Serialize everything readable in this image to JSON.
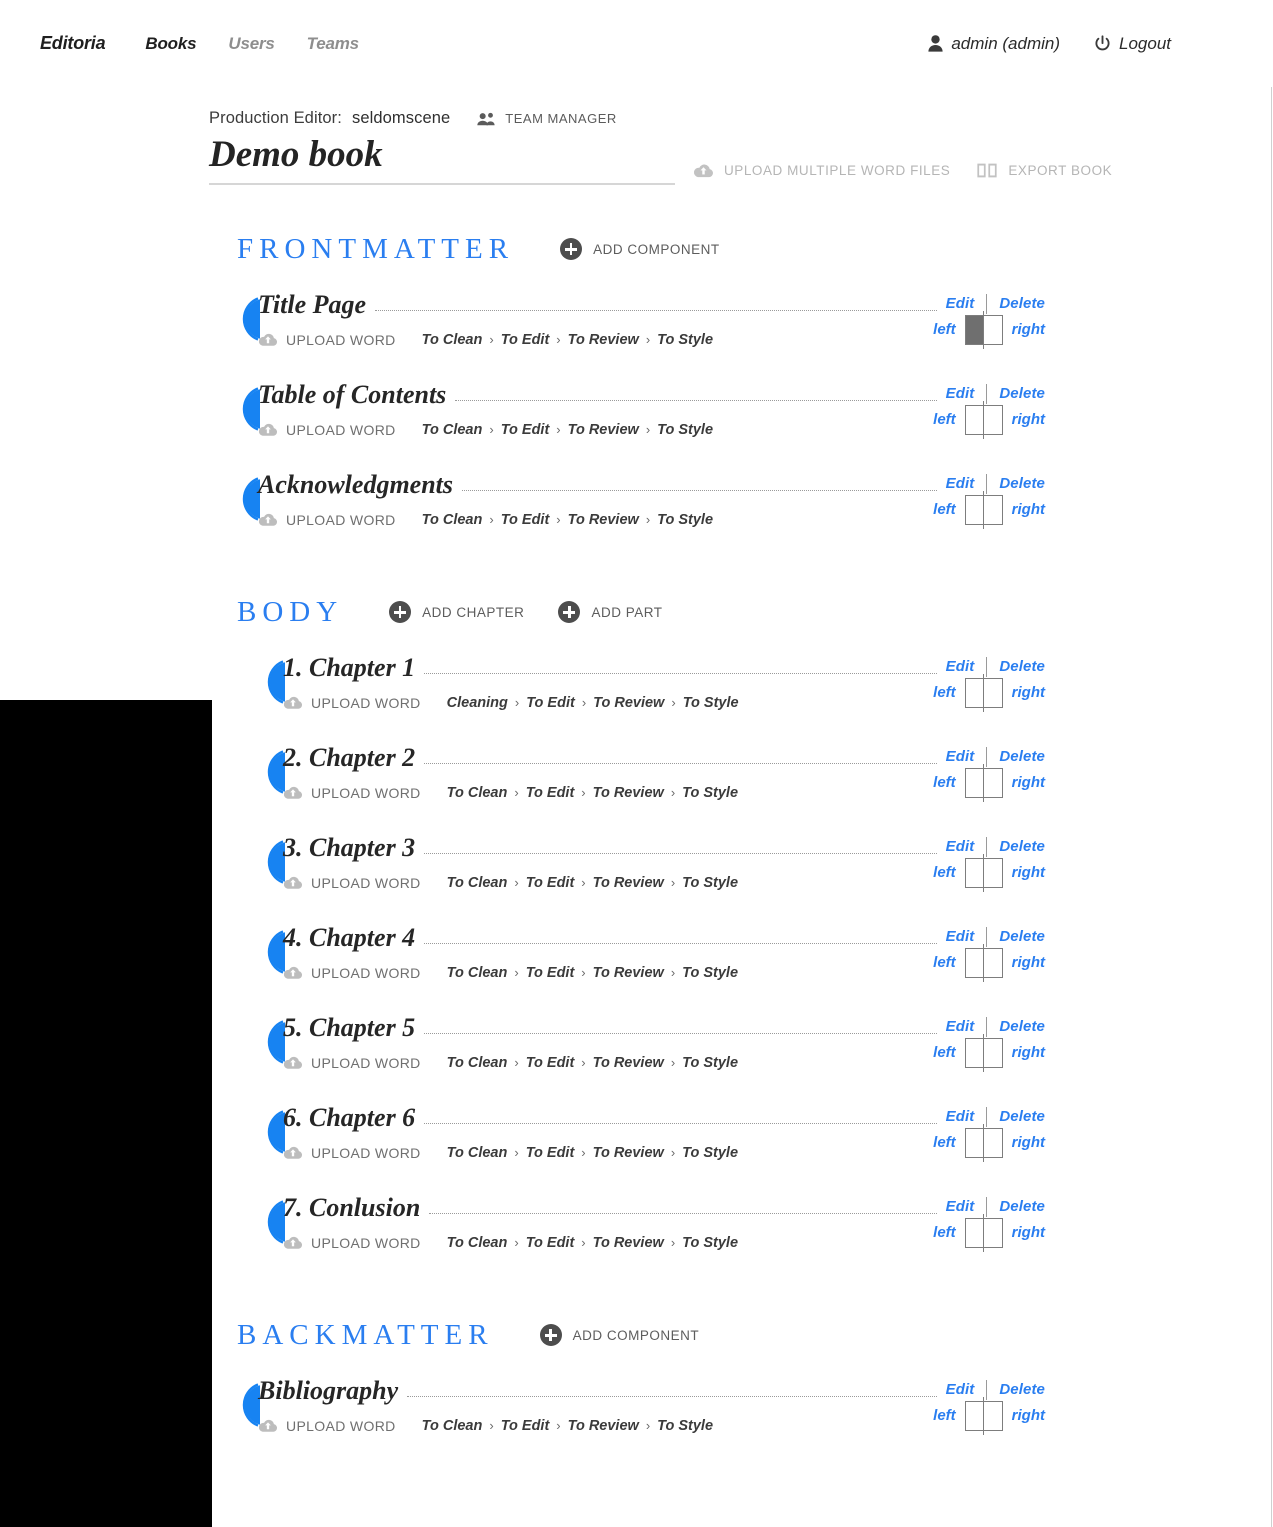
{
  "nav": {
    "brand": "Editoria",
    "items": [
      {
        "label": "Books",
        "active": true
      },
      {
        "label": "Users",
        "active": false
      },
      {
        "label": "Teams",
        "active": false
      }
    ],
    "user_label": "admin (admin)",
    "user_icon": "person-icon",
    "logout_label": "Logout",
    "logout_icon": "power-icon"
  },
  "book": {
    "role_label": "Production Editor:",
    "role_user": "seldomscene",
    "team_icon": "people-icon",
    "team_label": "TEAM MANAGER",
    "title": "Demo book",
    "upload_multiple_label": "UPLOAD MULTIPLE WORD FILES",
    "upload_multiple_icon": "cloud-upload-icon",
    "export_label": "EXPORT BOOK",
    "export_icon": "book-icon"
  },
  "labels": {
    "edit": "Edit",
    "delete": "Delete",
    "upload_word": "UPLOAD WORD",
    "upload_word_icon": "cloud-upload-icon",
    "left": "left",
    "right": "right",
    "add_component": "ADD COMPONENT",
    "add_chapter": "ADD CHAPTER",
    "add_part": "ADD PART",
    "workflow_sep": "›"
  },
  "colors": {
    "accent_blue": "#2a7ef0",
    "division_blue": "#2a7ef0",
    "text_dark": "#262626",
    "muted": "#6f6f6f",
    "light_muted": "#b5b5b5"
  },
  "divisions": [
    {
      "name": "FRONTMATTER",
      "actions": [
        {
          "label": "ADD COMPONENT",
          "icon": "plus-circle-icon"
        }
      ],
      "components": [
        {
          "title": "Title Page",
          "workflow": [
            "To Clean",
            "To Edit",
            "To Review",
            "To Style"
          ],
          "align": "left"
        },
        {
          "title": "Table of Contents",
          "workflow": [
            "To Clean",
            "To Edit",
            "To Review",
            "To Style"
          ],
          "align": "none"
        },
        {
          "title": "Acknowledgments",
          "workflow": [
            "To Clean",
            "To Edit",
            "To Review",
            "To Style"
          ],
          "align": "none"
        }
      ]
    },
    {
      "name": "BODY",
      "actions": [
        {
          "label": "ADD CHAPTER",
          "icon": "plus-circle-icon"
        },
        {
          "label": "ADD PART",
          "icon": "plus-circle-icon"
        }
      ],
      "components": [
        {
          "title": "1. Chapter 1",
          "workflow": [
            "Cleaning",
            "To Edit",
            "To Review",
            "To Style"
          ],
          "align": "none"
        },
        {
          "title": "2. Chapter 2",
          "workflow": [
            "To Clean",
            "To Edit",
            "To Review",
            "To Style"
          ],
          "align": "none"
        },
        {
          "title": "3. Chapter 3",
          "workflow": [
            "To Clean",
            "To Edit",
            "To Review",
            "To Style"
          ],
          "align": "none"
        },
        {
          "title": "4. Chapter 4",
          "workflow": [
            "To Clean",
            "To Edit",
            "To Review",
            "To Style"
          ],
          "align": "none"
        },
        {
          "title": "5. Chapter 5",
          "workflow": [
            "To Clean",
            "To Edit",
            "To Review",
            "To Style"
          ],
          "align": "none"
        },
        {
          "title": "6. Chapter 6",
          "workflow": [
            "To Clean",
            "To Edit",
            "To Review",
            "To Style"
          ],
          "align": "none"
        },
        {
          "title": "7. Conlusion",
          "workflow": [
            "To Clean",
            "To Edit",
            "To Review",
            "To Style"
          ],
          "align": "none"
        }
      ]
    },
    {
      "name": "BACKMATTER",
      "actions": [
        {
          "label": "ADD COMPONENT",
          "icon": "plus-circle-icon"
        }
      ],
      "components": [
        {
          "title": "Bibliography",
          "workflow": [
            "To Clean",
            "To Edit",
            "To Review",
            "To Style"
          ],
          "align": "none"
        }
      ]
    }
  ]
}
